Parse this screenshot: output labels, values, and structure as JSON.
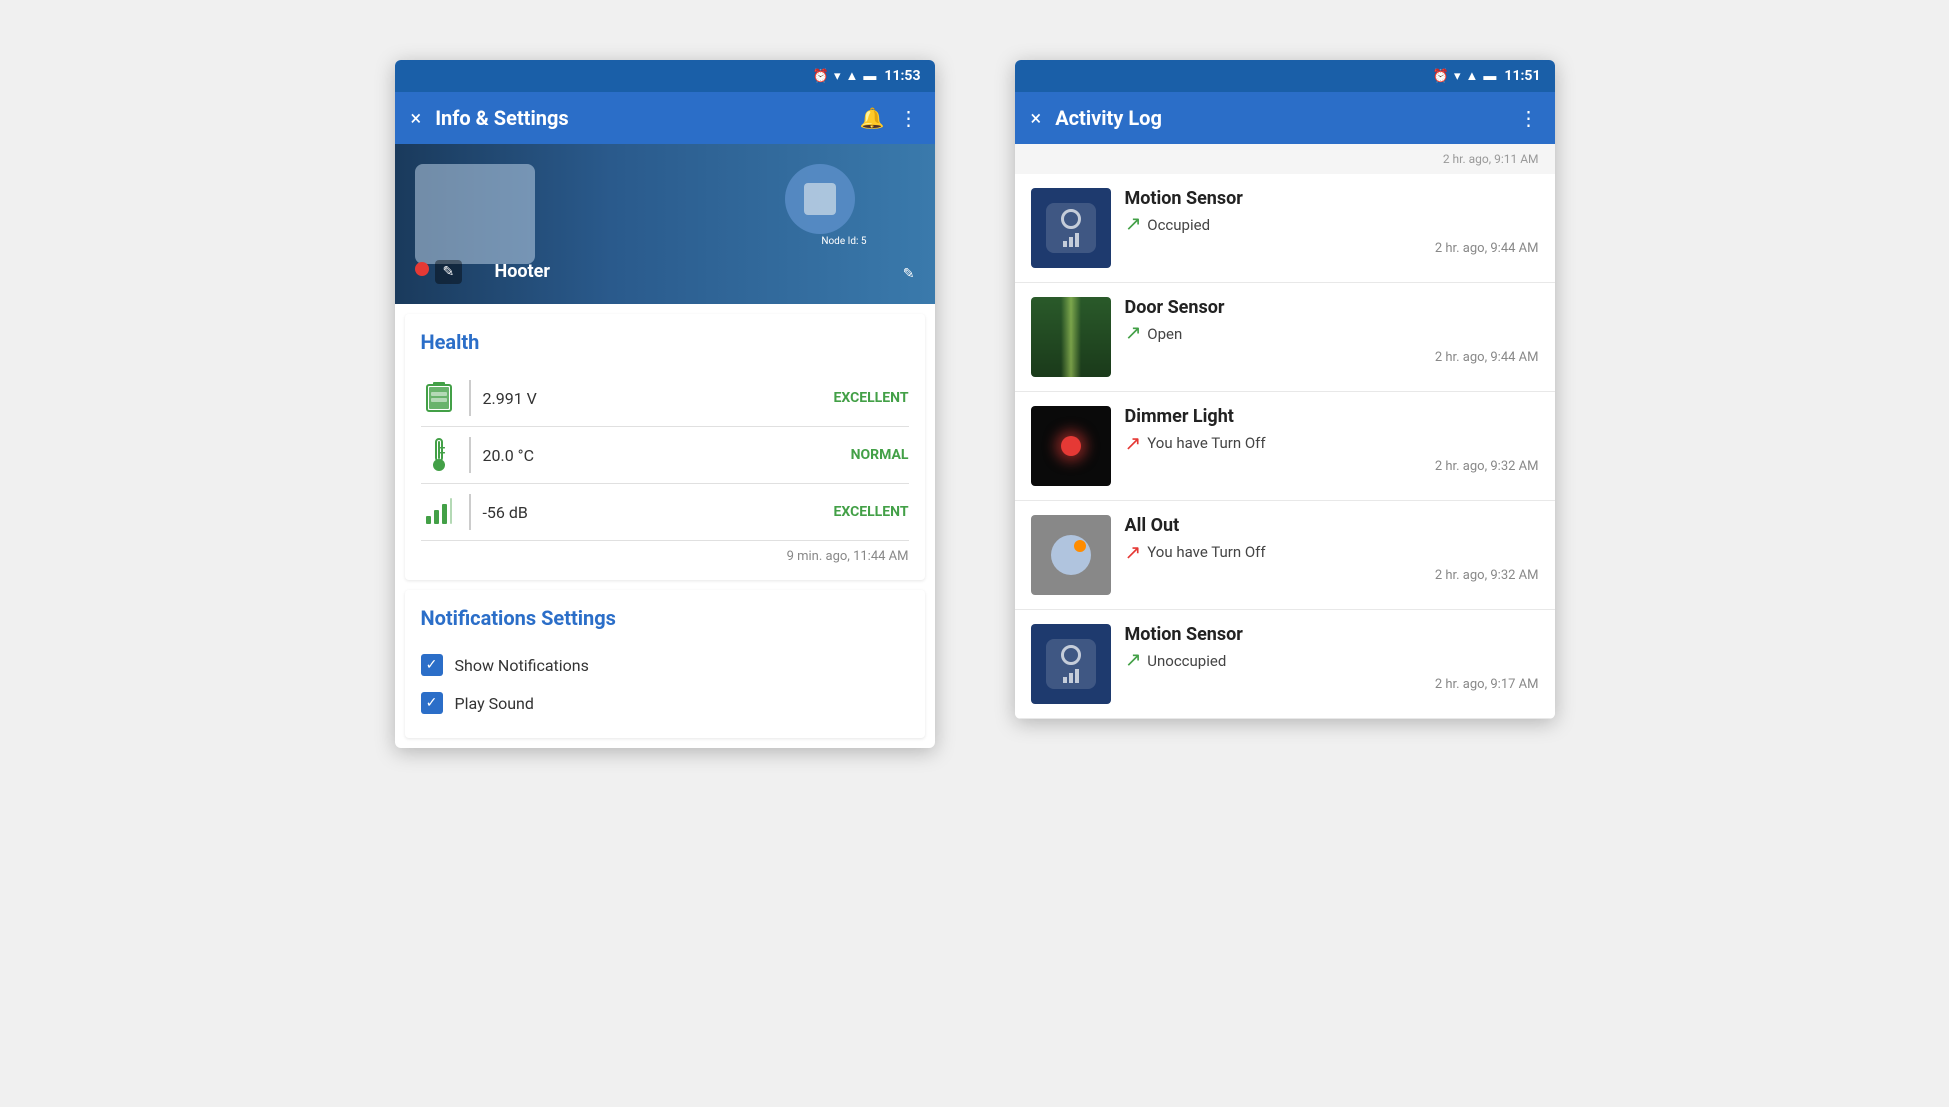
{
  "left_phone": {
    "status_bar": {
      "time": "11:53",
      "icons": [
        "alarm",
        "wifi",
        "signal",
        "battery"
      ]
    },
    "app_bar": {
      "title": "Info & Settings",
      "close_label": "×",
      "notification_icon": "🔔",
      "more_icon": "⋮"
    },
    "hero": {
      "device_name": "Hooter",
      "node_label": "Node Id: 5",
      "edit_icon": "✎"
    },
    "health": {
      "title": "Health",
      "rows": [
        {
          "icon": "battery",
          "value": "2.991 V",
          "status": "EXCELLENT",
          "status_class": "status-excellent"
        },
        {
          "icon": "thermometer",
          "value": "20.0 °C",
          "status": "NORMAL",
          "status_class": "status-normal"
        },
        {
          "icon": "signal",
          "value": "-56 dB",
          "status": "EXCELLENT",
          "status_class": "status-excellent"
        }
      ],
      "timestamp": "9 min. ago, 11:44 AM"
    },
    "notifications": {
      "title": "Notifications Settings",
      "items": [
        {
          "label": "Show Notifications",
          "checked": true
        },
        {
          "label": "Play Sound",
          "checked": true
        }
      ]
    }
  },
  "right_phone": {
    "status_bar": {
      "time": "11:51",
      "icons": [
        "alarm",
        "wifi",
        "signal",
        "battery"
      ]
    },
    "app_bar": {
      "title": "Activity Log",
      "close_label": "×",
      "more_icon": "⋮"
    },
    "partial_header": {
      "text": "2 hr. ago, 9:11 AM"
    },
    "entries": [
      {
        "name": "Motion Sensor",
        "status_text": "Occupied",
        "direction": "in",
        "time": "2 hr. ago, 9:44 AM",
        "thumb_type": "motion"
      },
      {
        "name": "Door Sensor",
        "status_text": "Open",
        "direction": "in",
        "time": "2 hr. ago, 9:44 AM",
        "thumb_type": "door"
      },
      {
        "name": "Dimmer Light",
        "status_text": "You have Turn Off",
        "direction": "out",
        "time": "2 hr. ago, 9:32 AM",
        "thumb_type": "dimmer"
      },
      {
        "name": "All Out",
        "status_text": "You have Turn Off",
        "direction": "out",
        "time": "2 hr. ago, 9:32 AM",
        "thumb_type": "allout"
      },
      {
        "name": "Motion Sensor",
        "status_text": "Unoccupied",
        "direction": "in",
        "time": "2 hr. ago, 9:17 AM",
        "thumb_type": "motion2"
      }
    ]
  }
}
